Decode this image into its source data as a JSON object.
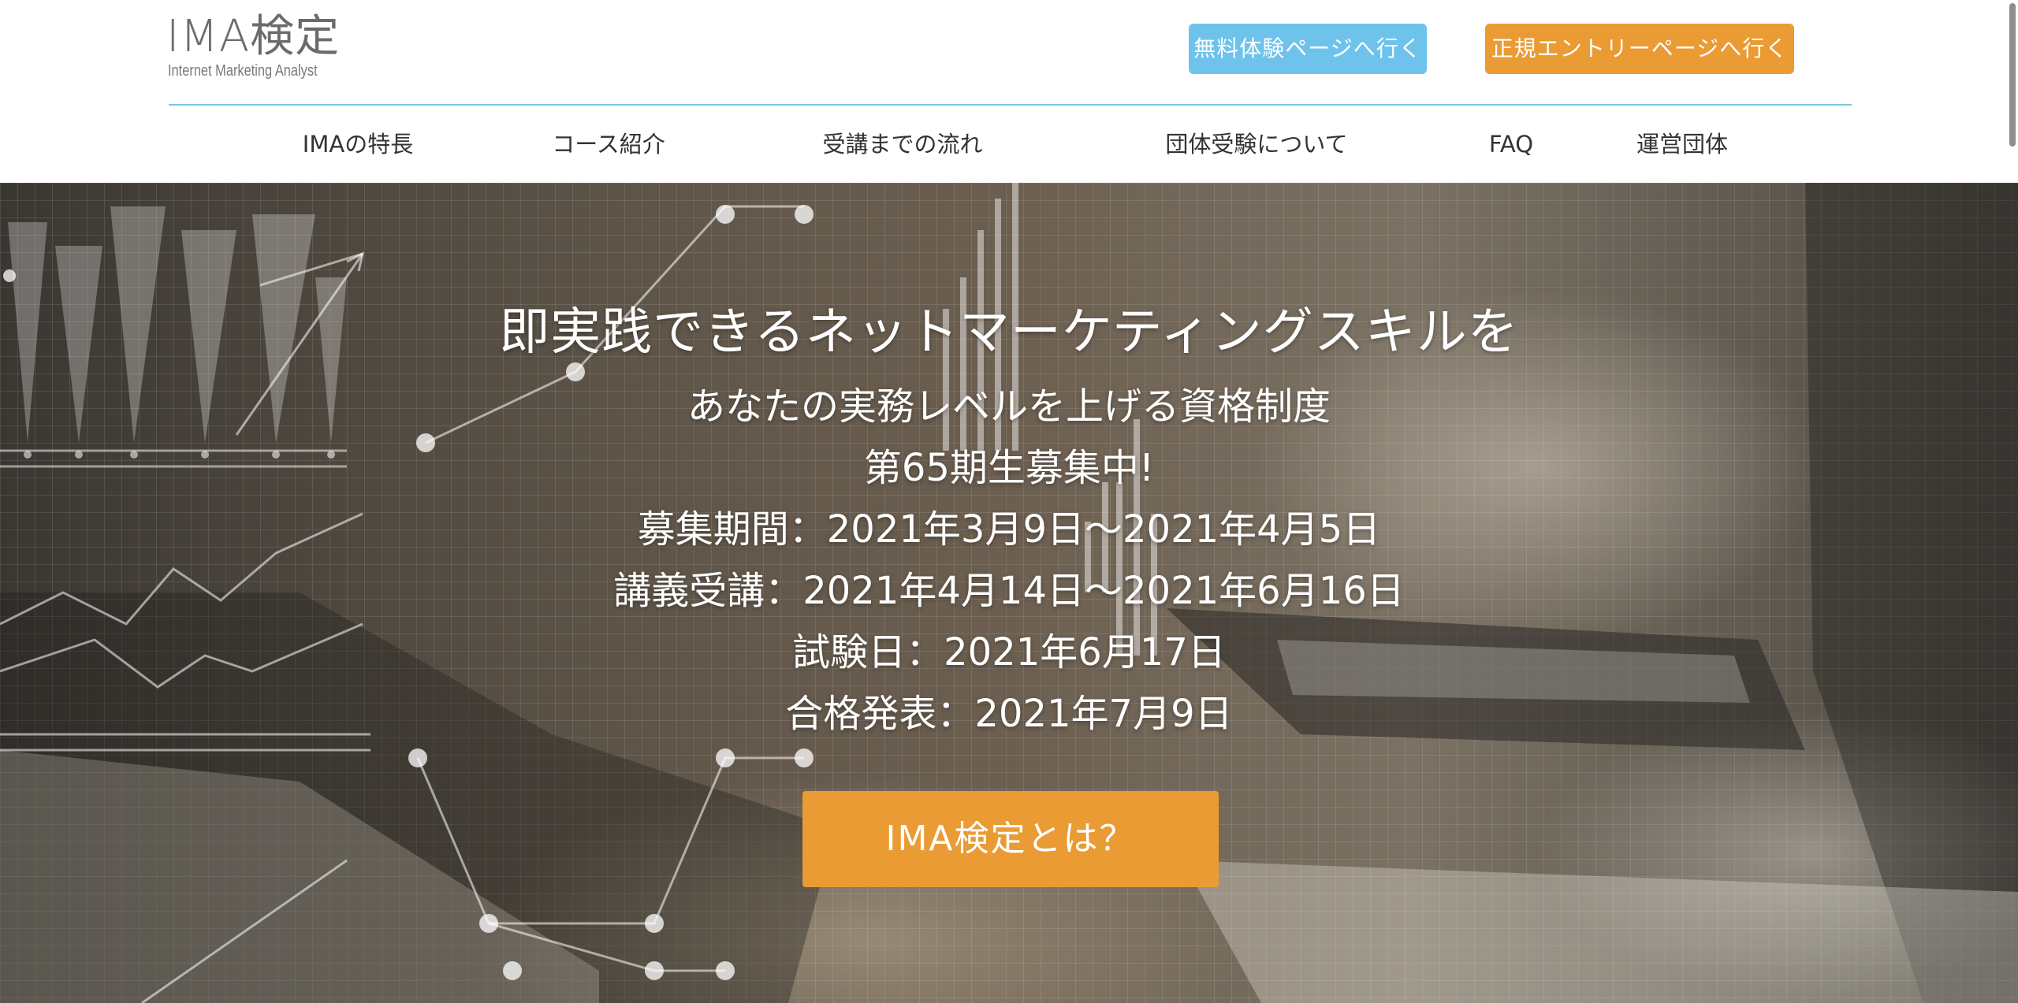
{
  "logo": {
    "main": "IMA検定",
    "sub": "Internet Marketing Analyst"
  },
  "header": {
    "trial_button": "無料体験ページへ行く",
    "entry_button": "正規エントリーページへ行く"
  },
  "nav": {
    "items": [
      {
        "label": "IMAの特長"
      },
      {
        "label": "コース紹介"
      },
      {
        "label": "受講までの流れ"
      },
      {
        "label": "団体受験について"
      },
      {
        "label": "FAQ"
      },
      {
        "label": "運営団体"
      }
    ]
  },
  "hero": {
    "headline": "即実践できるネットマーケティングスキルを",
    "subheadline": "あなたの実務レベルを上げる資格制度",
    "recruiting": "第65期生募集中!",
    "recruit_period": "募集期間：2021年3月9日～2021年4月5日",
    "lecture_period": "講義受講：2021年4月14日～2021年6月16日",
    "exam_date": "試験日：2021年6月17日",
    "result_date": "合格発表：2021年7月9日",
    "cta_label": "IMA検定とは？"
  },
  "colors": {
    "accent_orange": "#ea9b34",
    "accent_blue": "#6ec3ec",
    "rule_blue": "#7ec6e4"
  }
}
